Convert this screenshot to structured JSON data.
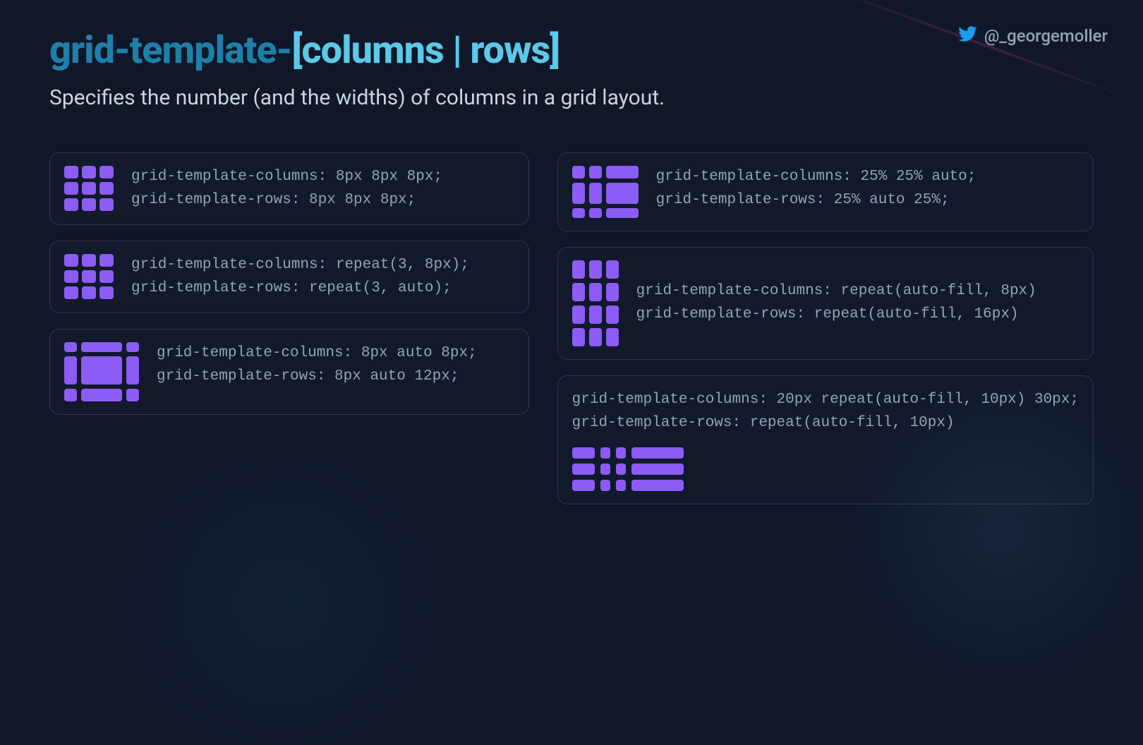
{
  "social": {
    "handle": "@_georgemoller"
  },
  "title": {
    "prefix": "grid-template-",
    "suffix": "[columns | rows]"
  },
  "subtitle": "Specifies the number (and the widths) of columns in a grid layout.",
  "cards": [
    {
      "cols": "grid-template-columns: 8px 8px 8px;",
      "rows": "grid-template-rows: 8px 8px 8px;"
    },
    {
      "cols": "grid-template-columns: repeat(3, 8px);",
      "rows": "grid-template-rows: repeat(3, auto);"
    },
    {
      "cols": "grid-template-columns: 8px auto 8px;",
      "rows": "grid-template-rows: 8px auto 12px;"
    },
    {
      "cols": "grid-template-columns: 25% 25% auto;",
      "rows": "grid-template-rows: 25% auto 25%;"
    },
    {
      "cols": "grid-template-columns: repeat(auto-fill, 8px)",
      "rows": "grid-template-rows: repeat(auto-fill, 16px)"
    },
    {
      "cols": "grid-template-columns: 20px repeat(auto-fill, 10px) 30px;",
      "rows": "grid-template-rows: repeat(auto-fill, 10px)"
    }
  ]
}
